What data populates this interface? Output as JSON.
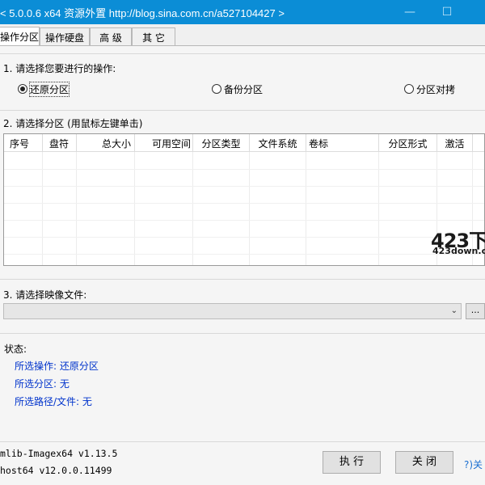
{
  "window": {
    "title": "< 5.0.0.6 x64 资源外置 http://blog.sina.com.cn/a527104427 >",
    "minimize_icon": "minimize-icon",
    "maximize_icon": "maximize-icon"
  },
  "tabs": [
    {
      "label": "操作分区",
      "active": true
    },
    {
      "label": "操作硬盘",
      "active": false
    },
    {
      "label": "高 级",
      "active": false
    },
    {
      "label": "其 它",
      "active": false
    }
  ],
  "step1": {
    "label": "1. 请选择您要进行的操作:",
    "options": [
      {
        "label": "还原分区",
        "selected": true
      },
      {
        "label": "备份分区",
        "selected": false
      },
      {
        "label": "分区对拷",
        "selected": false
      }
    ]
  },
  "step2": {
    "label": "2. 请选择分区 (用鼠标左键单击)",
    "columns": [
      "序号",
      "盘符",
      "总大小",
      "可用空间",
      "分区类型",
      "文件系统",
      "卷标",
      "分区形式",
      "激活"
    ],
    "rows": []
  },
  "watermark": {
    "big": "423下",
    "small": "423down.com"
  },
  "step3": {
    "label": "3. 请选择映像文件:",
    "value": "",
    "browse_label": "..."
  },
  "status": {
    "label": "状态:",
    "operation": "所选操作: 还原分区",
    "partition": "所选分区: 无",
    "path": "所选路径/文件: 无"
  },
  "footer": {
    "version1": "mlib-Imagex64 v1.13.5",
    "version2": "host64 v12.0.0.11499",
    "execute_label": "执 行",
    "close_label": "关 闭",
    "help_link": "?)关"
  }
}
